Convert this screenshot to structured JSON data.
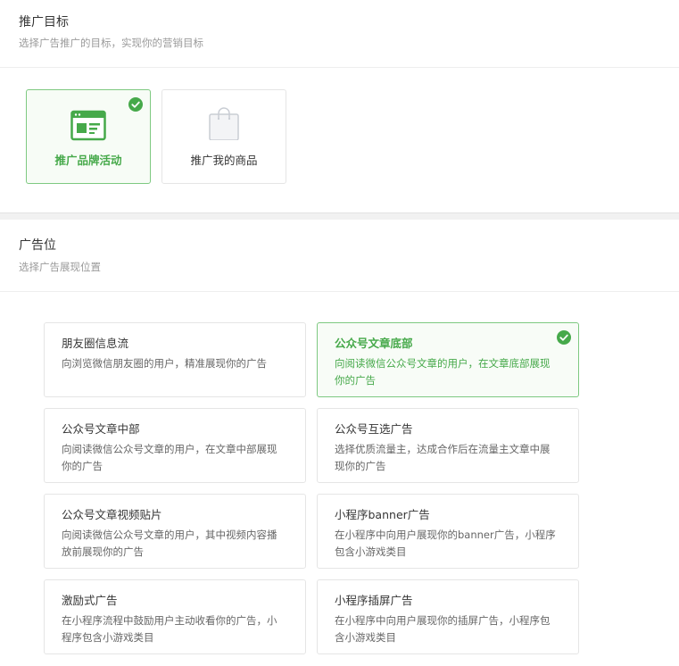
{
  "goal_section": {
    "title": "推广目标",
    "subtitle": "选择广告推广的目标，实现你的营销目标",
    "options": [
      {
        "label": "推广品牌活动",
        "icon": "browser-window-icon",
        "selected": true
      },
      {
        "label": "推广我的商品",
        "icon": "shopping-bag-icon",
        "selected": false
      }
    ]
  },
  "position_section": {
    "title": "广告位",
    "subtitle": "选择广告展现位置",
    "options": [
      {
        "title": "朋友圈信息流",
        "desc": "向浏览微信朋友圈的用户，精准展现你的广告",
        "selected": false
      },
      {
        "title": "公众号文章底部",
        "desc": "向阅读微信公众号文章的用户，在文章底部展现你的广告",
        "selected": true
      },
      {
        "title": "公众号文章中部",
        "desc": "向阅读微信公众号文章的用户，在文章中部展现你的广告",
        "selected": false
      },
      {
        "title": "公众号互选广告",
        "desc": "选择优质流量主，达成合作后在流量主文章中展现你的广告",
        "selected": false
      },
      {
        "title": "公众号文章视频贴片",
        "desc": "向阅读微信公众号文章的用户，其中视频内容播放前展现你的广告",
        "selected": false
      },
      {
        "title": "小程序banner广告",
        "desc": "在小程序中向用户展现你的banner广告，小程序包含小游戏类目",
        "selected": false
      },
      {
        "title": "激励式广告",
        "desc": "在小程序流程中鼓励用户主动收看你的广告，小程序包含小游戏类目",
        "selected": false
      },
      {
        "title": "小程序插屏广告",
        "desc": "在小程序中向用户展现你的插屏广告，小程序包含小游戏类目",
        "selected": false
      }
    ]
  },
  "colors": {
    "accent": "#46a94a",
    "border": "#e5e5e5",
    "muted": "#9a9a9a"
  }
}
